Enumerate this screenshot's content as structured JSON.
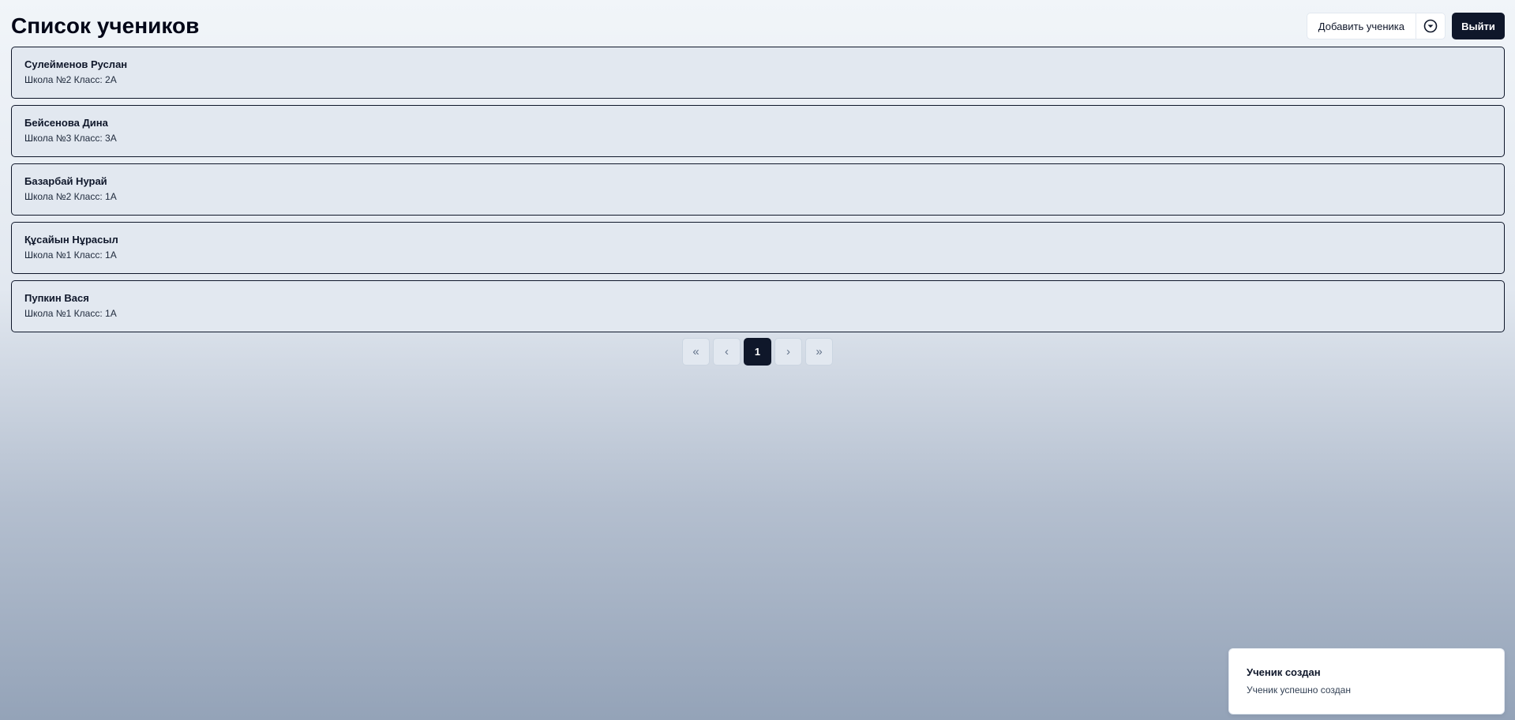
{
  "header": {
    "title": "Список учеников",
    "add_student_label": "Добавить ученика",
    "dropdown_icon": "chevron-down-circle-icon",
    "logout_label": "Выйти"
  },
  "students": [
    {
      "name": "Сулейменов Руслан",
      "meta": "Школа №2 Класс: 2А"
    },
    {
      "name": "Бейсенова Дина",
      "meta": "Школа №3 Класс: 3А"
    },
    {
      "name": "Базарбай Нурай",
      "meta": "Школа №2 Класс: 1А"
    },
    {
      "name": "Құсайын Нұрасыл",
      "meta": "Школа №1 Класс: 1А"
    },
    {
      "name": "Пупкин Вася",
      "meta": "Школа №1 Класс: 1А"
    }
  ],
  "pagination": {
    "first": "«",
    "prev": "‹",
    "current": "1",
    "next": "›",
    "last": "»"
  },
  "toast": {
    "title": "Ученик создан",
    "description": "Ученик успешно создан"
  },
  "colors": {
    "primary": "#0f172a",
    "card_bg": "#e2e8f0",
    "gradient_top": "#f1f5f9",
    "gradient_bottom": "#94a3b8"
  }
}
